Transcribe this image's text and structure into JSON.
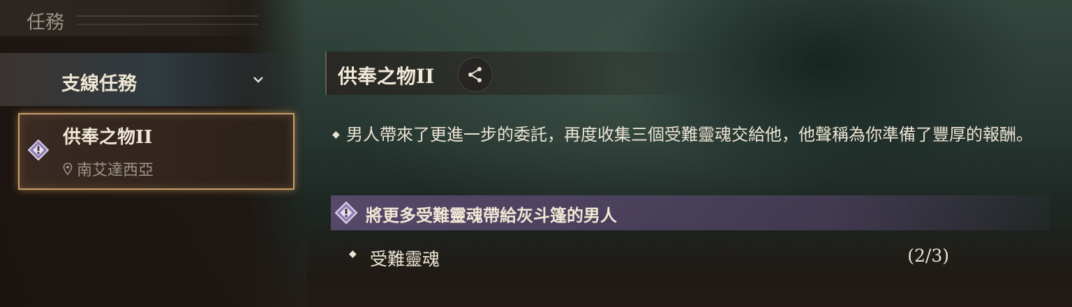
{
  "header": {
    "title": "任務"
  },
  "sidebar": {
    "category": {
      "label": "支線任務",
      "icon": "chevron-down-icon"
    },
    "quests": [
      {
        "name": "供奉之物II",
        "location": "南艾達西亞",
        "icon": "quest-diamond-icon"
      }
    ]
  },
  "detail": {
    "title": "供奉之物II",
    "share_icon": "share-icon",
    "description": "男人帶來了更進一步的委託，再度收集三個受難靈魂交給他，他聲稱為你準備了豐厚的報酬。",
    "objective": "將更多受難靈魂帶給灰斗篷的男人",
    "sub_objectives": [
      {
        "label": "受難靈魂",
        "progress": "(2/3)"
      }
    ]
  },
  "colors": {
    "accent_gold": "#c9a068",
    "objective_purple": "#5f4e76"
  }
}
